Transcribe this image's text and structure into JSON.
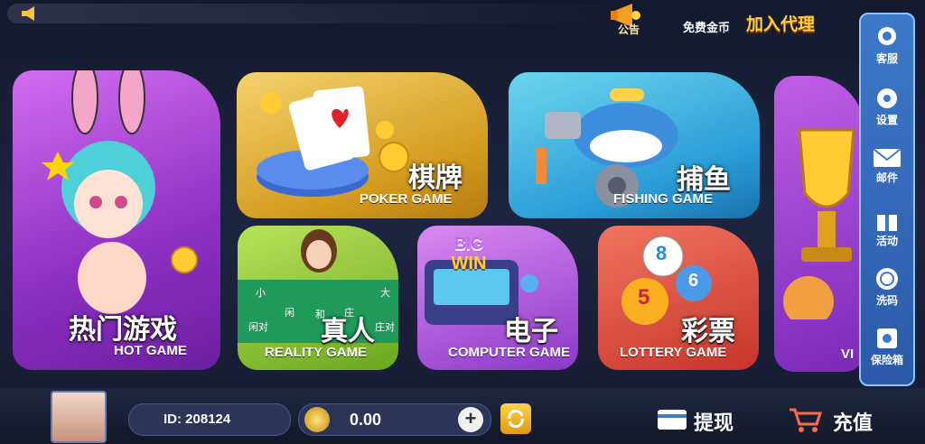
{
  "header": {
    "notice_label": "公告",
    "free_coins_label": "免费金币",
    "agent_label": "加入代理"
  },
  "games": {
    "hot": {
      "cn": "热门游戏",
      "en": "HOT GAME"
    },
    "poker": {
      "cn": "棋牌",
      "en": "POKER GAME"
    },
    "fishing": {
      "cn": "捕鱼",
      "en": "FISHING GAME"
    },
    "reality": {
      "cn": "真人",
      "en": "REALITY GAME",
      "table_labels": [
        "小",
        "闲",
        "和",
        "庄",
        "大",
        "闲对",
        "庄对"
      ]
    },
    "computer": {
      "cn": "电子",
      "en": "COMPUTER GAME",
      "logo_big": "BIG",
      "logo_win": "WIN"
    },
    "lottery": {
      "cn": "彩票",
      "en": "LOTTERY GAME",
      "balls": [
        "8",
        "5",
        "6"
      ]
    },
    "vip": {
      "en": "VI"
    }
  },
  "sidebar": {
    "items": [
      {
        "label": "客服",
        "icon": "customer-service-icon"
      },
      {
        "label": "设置",
        "icon": "gear-icon"
      },
      {
        "label": "邮件",
        "icon": "mail-icon"
      },
      {
        "label": "活动",
        "icon": "gift-icon"
      },
      {
        "label": "洗码",
        "icon": "chip-icon"
      },
      {
        "label": "保险箱",
        "icon": "safe-icon"
      }
    ]
  },
  "footer": {
    "user_id": "ID: 208124",
    "balance": "0.00",
    "withdraw_label": "提现",
    "recharge_label": "充值"
  },
  "colors": {
    "accent": "#ffcf3a",
    "sidebar": "#3d79c9"
  }
}
